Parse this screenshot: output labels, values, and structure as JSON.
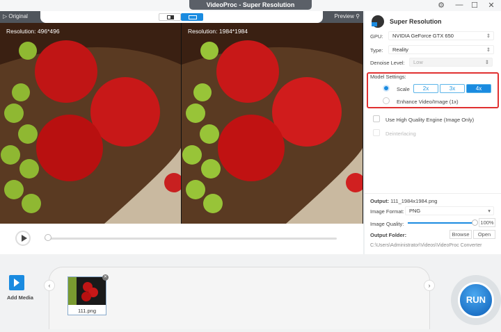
{
  "window": {
    "title": "VideoProc - Super Resolution",
    "settings_icon": "gear-icon",
    "minimize": "—",
    "maximize": "☐",
    "close": "✕"
  },
  "viewer": {
    "original_label": "▷ Original",
    "preview_label": "Preview",
    "left_resolution": "Resolution: 496*496",
    "right_resolution": "Resolution: 1984*1984",
    "progress": 0
  },
  "panel": {
    "title": "Super Resolution",
    "gpu_label": "GPU:",
    "gpu_value": "NVIDIA GeForce GTX 650",
    "type_label": "Type:",
    "type_value": "Reality",
    "denoise_label": "Denoise Level:",
    "denoise_value": "Low",
    "model_settings_label": "Model Settings:",
    "scale_label": "Scale",
    "scale_options": [
      "2x",
      "3x",
      "4x"
    ],
    "scale_selected": "4x",
    "enhance_label": "Enhance Video/Image (1x)",
    "hq_engine_label": "Use High Quality Engine (Image Only)",
    "deinterlacing_label": "Deinterlacing",
    "output_label": "Output:",
    "output_value": "111_1984x1984.png",
    "format_label": "Image Format:",
    "format_value": "PNG",
    "quality_label": "Image Quality:",
    "quality_value": "100%",
    "quality_fraction": 1.0,
    "folder_label": "Output Folder:",
    "browse": "Browse",
    "open": "Open",
    "folder_path": "C:\\Users\\Administrator\\Videos\\VideoProc Converter"
  },
  "media": {
    "add_media": "Add Media",
    "file_name": "111.png",
    "run": "RUN",
    "prev": "‹",
    "next": "›"
  }
}
